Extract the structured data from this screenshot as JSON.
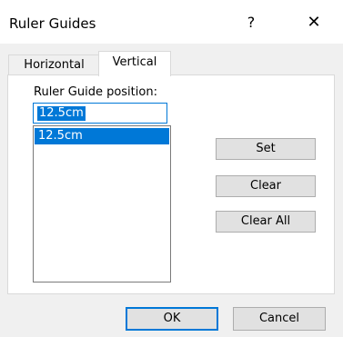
{
  "window": {
    "title": "Ruler Guides",
    "help_glyph": "?",
    "close_glyph": "✕"
  },
  "tabs": [
    {
      "label": "Horizontal",
      "selected": false
    },
    {
      "label": "Vertical",
      "selected": true
    }
  ],
  "panel": {
    "field_label": "Ruler Guide position:",
    "position_value": "12.5cm",
    "guides": [
      "12.5cm"
    ],
    "selected_guide": "12.5cm"
  },
  "buttons": {
    "set": "Set",
    "clear": "Clear",
    "clear_all": "Clear All",
    "ok": "OK",
    "cancel": "Cancel"
  },
  "colors": {
    "accent": "#0078d7",
    "background": "#f0f0f0"
  },
  "icons": {
    "help": "help-icon",
    "close": "close-icon"
  }
}
